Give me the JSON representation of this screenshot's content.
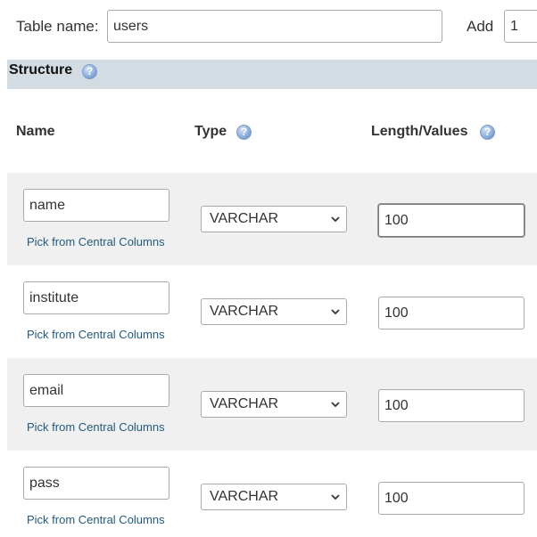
{
  "header": {
    "table_name_label": "Table name:",
    "table_name_value": "users",
    "add_label": "Add",
    "add_count_value": "1"
  },
  "structure": {
    "title": "Structure",
    "help_icon": "help-icon"
  },
  "columns": {
    "name_header": "Name",
    "type_header": "Type",
    "length_header": "Length/Values"
  },
  "rows": [
    {
      "name": "name",
      "pick_link": "Pick from Central Columns",
      "type": "VARCHAR",
      "length": "100"
    },
    {
      "name": "institute",
      "pick_link": "Pick from Central Columns",
      "type": "VARCHAR",
      "length": "100"
    },
    {
      "name": "email",
      "pick_link": "Pick from Central Columns",
      "type": "VARCHAR",
      "length": "100"
    },
    {
      "name": "pass",
      "pick_link": "Pick from Central Columns",
      "type": "VARCHAR",
      "length": "100"
    }
  ],
  "colors": {
    "structure_bar": "#d3dce3",
    "row_shade": "#f0f0f0",
    "link": "#235a81"
  }
}
